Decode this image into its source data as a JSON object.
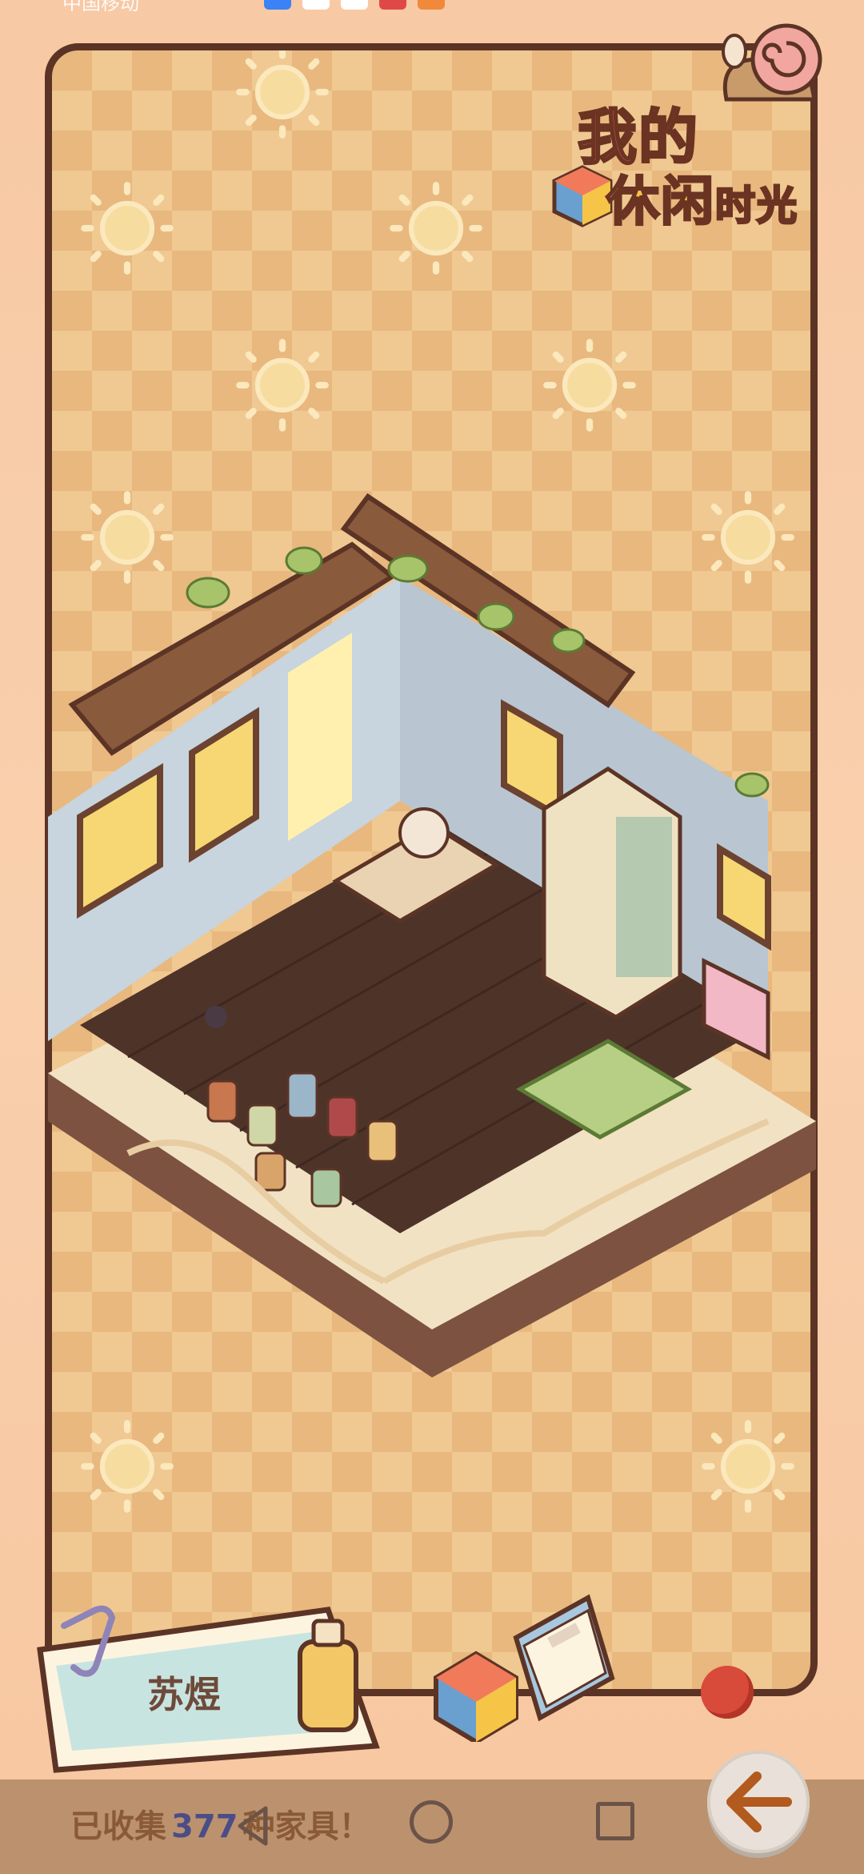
{
  "status_bar": {
    "carrier": "中国移动"
  },
  "title": {
    "line1": "我的",
    "line2_big": "休闲",
    "line2_small": "时光"
  },
  "player": {
    "name": "苏煜"
  },
  "collection": {
    "prefix": "已收集",
    "count": "377",
    "suffix": "种家具！"
  },
  "colors": {
    "frame": "#5c3426",
    "background": "#e8b87e",
    "accent_red": "#e85a5a",
    "accent_yellow": "#f6c446"
  },
  "icons": [
    "sun-icon",
    "snail-icon",
    "paperclip-icon",
    "bottle-icon",
    "rubiks-cube-icon",
    "book-icon",
    "back-arrow-icon"
  ]
}
